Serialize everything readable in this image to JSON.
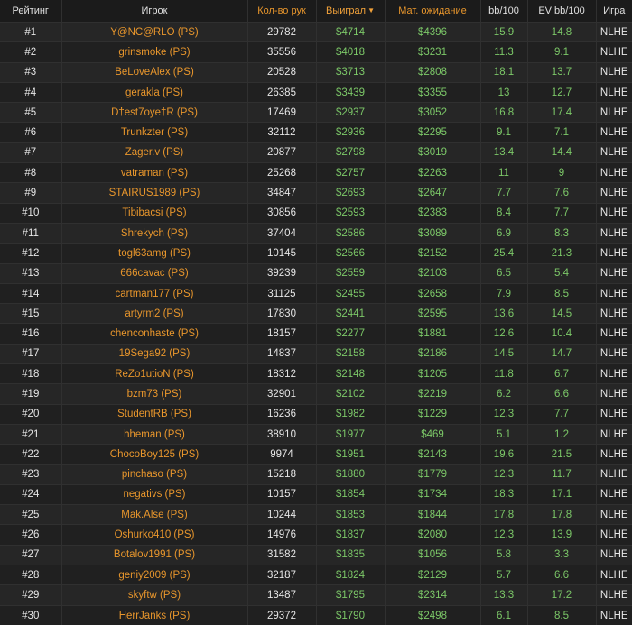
{
  "table": {
    "columns": {
      "rank": "Рейтинг",
      "player": "Игрок",
      "hands": "Кол-во рук",
      "won": "Выиграл",
      "ev": "Мат. ожидание",
      "bb100": "bb/100",
      "evbb100": "EV bb/100",
      "game": "Игра"
    },
    "sorted_column": "won",
    "colors": {
      "accent": "#e8962c",
      "positive": "#7cc868",
      "text": "#e6e6e6"
    },
    "rows": [
      {
        "rank": "#1",
        "player": "Y@NC@RLO (PS)",
        "hands": "29782",
        "won": "$4714",
        "ev": "$4396",
        "bb100": "15.9",
        "evbb100": "14.8",
        "game": "NLHE"
      },
      {
        "rank": "#2",
        "player": "grinsmoke (PS)",
        "hands": "35556",
        "won": "$4018",
        "ev": "$3231",
        "bb100": "11.3",
        "evbb100": "9.1",
        "game": "NLHE"
      },
      {
        "rank": "#3",
        "player": "BeLoveAlex (PS)",
        "hands": "20528",
        "won": "$3713",
        "ev": "$2808",
        "bb100": "18.1",
        "evbb100": "13.7",
        "game": "NLHE"
      },
      {
        "rank": "#4",
        "player": "gerakla (PS)",
        "hands": "26385",
        "won": "$3439",
        "ev": "$3355",
        "bb100": "13",
        "evbb100": "12.7",
        "game": "NLHE"
      },
      {
        "rank": "#5",
        "player": "D†est7oye†R (PS)",
        "hands": "17469",
        "won": "$2937",
        "ev": "$3052",
        "bb100": "16.8",
        "evbb100": "17.4",
        "game": "NLHE"
      },
      {
        "rank": "#6",
        "player": "Trunkzter (PS)",
        "hands": "32112",
        "won": "$2936",
        "ev": "$2295",
        "bb100": "9.1",
        "evbb100": "7.1",
        "game": "NLHE"
      },
      {
        "rank": "#7",
        "player": "Zager.v (PS)",
        "hands": "20877",
        "won": "$2798",
        "ev": "$3019",
        "bb100": "13.4",
        "evbb100": "14.4",
        "game": "NLHE"
      },
      {
        "rank": "#8",
        "player": "vatraman (PS)",
        "hands": "25268",
        "won": "$2757",
        "ev": "$2263",
        "bb100": "11",
        "evbb100": "9",
        "game": "NLHE"
      },
      {
        "rank": "#9",
        "player": "STAIRUS1989 (PS)",
        "hands": "34847",
        "won": "$2693",
        "ev": "$2647",
        "bb100": "7.7",
        "evbb100": "7.6",
        "game": "NLHE"
      },
      {
        "rank": "#10",
        "player": "Tibibacsi (PS)",
        "hands": "30856",
        "won": "$2593",
        "ev": "$2383",
        "bb100": "8.4",
        "evbb100": "7.7",
        "game": "NLHE"
      },
      {
        "rank": "#11",
        "player": "Shrekych (PS)",
        "hands": "37404",
        "won": "$2586",
        "ev": "$3089",
        "bb100": "6.9",
        "evbb100": "8.3",
        "game": "NLHE"
      },
      {
        "rank": "#12",
        "player": "togl63amg (PS)",
        "hands": "10145",
        "won": "$2566",
        "ev": "$2152",
        "bb100": "25.4",
        "evbb100": "21.3",
        "game": "NLHE"
      },
      {
        "rank": "#13",
        "player": "666cavac (PS)",
        "hands": "39239",
        "won": "$2559",
        "ev": "$2103",
        "bb100": "6.5",
        "evbb100": "5.4",
        "game": "NLHE"
      },
      {
        "rank": "#14",
        "player": "cartman177 (PS)",
        "hands": "31125",
        "won": "$2455",
        "ev": "$2658",
        "bb100": "7.9",
        "evbb100": "8.5",
        "game": "NLHE"
      },
      {
        "rank": "#15",
        "player": "artyrm2 (PS)",
        "hands": "17830",
        "won": "$2441",
        "ev": "$2595",
        "bb100": "13.6",
        "evbb100": "14.5",
        "game": "NLHE"
      },
      {
        "rank": "#16",
        "player": "chenconhaste (PS)",
        "hands": "18157",
        "won": "$2277",
        "ev": "$1881",
        "bb100": "12.6",
        "evbb100": "10.4",
        "game": "NLHE"
      },
      {
        "rank": "#17",
        "player": "19Sega92 (PS)",
        "hands": "14837",
        "won": "$2158",
        "ev": "$2186",
        "bb100": "14.5",
        "evbb100": "14.7",
        "game": "NLHE"
      },
      {
        "rank": "#18",
        "player": "ReZo1utioN (PS)",
        "hands": "18312",
        "won": "$2148",
        "ev": "$1205",
        "bb100": "11.8",
        "evbb100": "6.7",
        "game": "NLHE"
      },
      {
        "rank": "#19",
        "player": "bzm73 (PS)",
        "hands": "32901",
        "won": "$2102",
        "ev": "$2219",
        "bb100": "6.2",
        "evbb100": "6.6",
        "game": "NLHE"
      },
      {
        "rank": "#20",
        "player": "StudentRB (PS)",
        "hands": "16236",
        "won": "$1982",
        "ev": "$1229",
        "bb100": "12.3",
        "evbb100": "7.7",
        "game": "NLHE"
      },
      {
        "rank": "#21",
        "player": "hheman (PS)",
        "hands": "38910",
        "won": "$1977",
        "ev": "$469",
        "bb100": "5.1",
        "evbb100": "1.2",
        "game": "NLHE"
      },
      {
        "rank": "#22",
        "player": "ChocoBoy125 (PS)",
        "hands": "9974",
        "won": "$1951",
        "ev": "$2143",
        "bb100": "19.6",
        "evbb100": "21.5",
        "game": "NLHE"
      },
      {
        "rank": "#23",
        "player": "pinchaso (PS)",
        "hands": "15218",
        "won": "$1880",
        "ev": "$1779",
        "bb100": "12.3",
        "evbb100": "11.7",
        "game": "NLHE"
      },
      {
        "rank": "#24",
        "player": "negativs (PS)",
        "hands": "10157",
        "won": "$1854",
        "ev": "$1734",
        "bb100": "18.3",
        "evbb100": "17.1",
        "game": "NLHE"
      },
      {
        "rank": "#25",
        "player": "Mak.Alse (PS)",
        "hands": "10244",
        "won": "$1853",
        "ev": "$1844",
        "bb100": "17.8",
        "evbb100": "17.8",
        "game": "NLHE"
      },
      {
        "rank": "#26",
        "player": "Oshurko410 (PS)",
        "hands": "14976",
        "won": "$1837",
        "ev": "$2080",
        "bb100": "12.3",
        "evbb100": "13.9",
        "game": "NLHE"
      },
      {
        "rank": "#27",
        "player": "Botalov1991 (PS)",
        "hands": "31582",
        "won": "$1835",
        "ev": "$1056",
        "bb100": "5.8",
        "evbb100": "3.3",
        "game": "NLHE"
      },
      {
        "rank": "#28",
        "player": "geniy2009 (PS)",
        "hands": "32187",
        "won": "$1824",
        "ev": "$2129",
        "bb100": "5.7",
        "evbb100": "6.6",
        "game": "NLHE"
      },
      {
        "rank": "#29",
        "player": "skyftw (PS)",
        "hands": "13487",
        "won": "$1795",
        "ev": "$2314",
        "bb100": "13.3",
        "evbb100": "17.2",
        "game": "NLHE"
      },
      {
        "rank": "#30",
        "player": "HerrJanks (PS)",
        "hands": "29372",
        "won": "$1790",
        "ev": "$2498",
        "bb100": "6.1",
        "evbb100": "8.5",
        "game": "NLHE"
      }
    ]
  }
}
